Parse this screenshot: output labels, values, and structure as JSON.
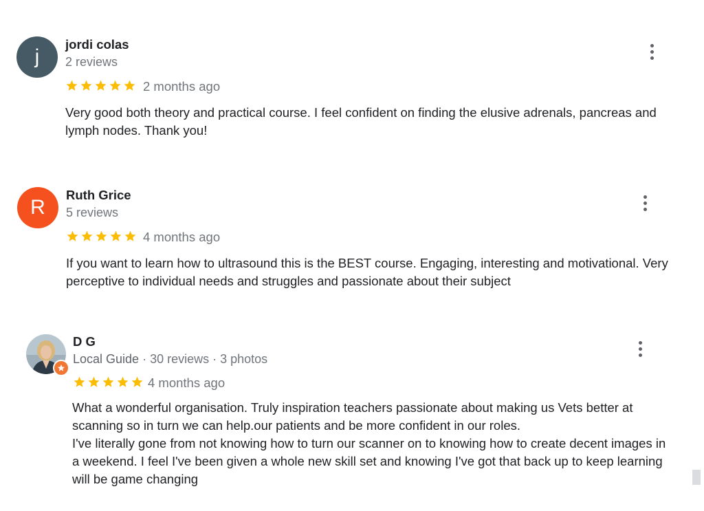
{
  "reviews": [
    {
      "avatar_initial": "j",
      "avatar_color": "#455a64",
      "name": "jordi colas",
      "meta": "2 reviews",
      "rating": 5,
      "time": "2 months ago",
      "text": [
        "Very good both theory and practical course. I feel confident on finding the elusive adrenals, pancreas and lymph nodes. Thank you!"
      ]
    },
    {
      "avatar_initial": "R",
      "avatar_color": "#f4511e",
      "name": "Ruth Grice",
      "meta": "5 reviews",
      "rating": 5,
      "time": "4 months ago",
      "text": [
        "If you want to learn how to ultrasound this is the BEST course. Engaging, interesting and motivational. Very perceptive to individual needs and struggles and passionate about their subject"
      ]
    },
    {
      "avatar_initial": "",
      "avatar_color": "#8a9aa6",
      "name": "D G",
      "meta_guide": "Local Guide",
      "meta_dot1": "·",
      "meta_reviews": "30 reviews",
      "meta_dot2": "·",
      "meta_photos": "3 photos",
      "rating": 5,
      "time": "4 months ago",
      "text": [
        "What a wonderful organisation. Truly inspiration teachers passionate about making us Vets better at scanning so in turn we can help.our patients and be more confident in our roles.",
        "I've literally gone from not knowing how to turn our scanner on to knowing how to create decent images in a weekend. I feel I've been given a whole new skill set and knowing I've got that back up to keep learning will be game changing"
      ]
    }
  ],
  "icons": {
    "star": "star-icon",
    "more": "more-vert-icon",
    "badge": "local-guide-badge-icon"
  },
  "colors": {
    "star": "#fbbc04",
    "secondary_text": "#70757a",
    "primary_text": "#202124"
  }
}
